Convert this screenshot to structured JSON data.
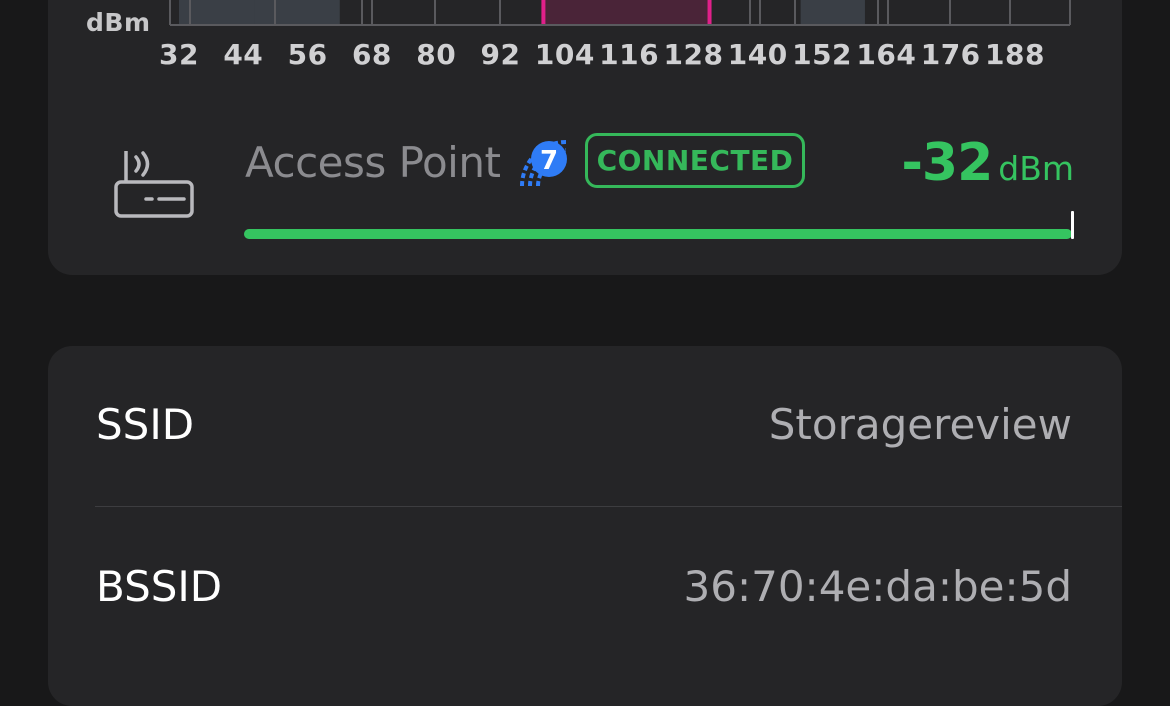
{
  "chart": {
    "unit_label": "dBm",
    "ticks": [
      "32",
      "44",
      "56",
      "68",
      "80",
      "92",
      "104",
      "116",
      "128",
      "140",
      "152",
      "164",
      "176",
      "188"
    ],
    "highlight_channel_range": [
      100,
      131
    ],
    "highlight_color": "#e0208a",
    "neighbor_bars_color": "#3a3f46"
  },
  "access_point": {
    "label": "Access Point",
    "wifi_generation": "7",
    "wifi_icon": "wifi-7-icon",
    "status": "CONNECTED",
    "signal_value": "-32",
    "signal_unit": "dBm",
    "signal_fraction": 1.0,
    "accent_color": "#35c460"
  },
  "details": {
    "rows": [
      {
        "label": "SSID",
        "value": "Storagereview"
      },
      {
        "label": "BSSID",
        "value": "36:70:4e:da:be:5d"
      }
    ]
  }
}
